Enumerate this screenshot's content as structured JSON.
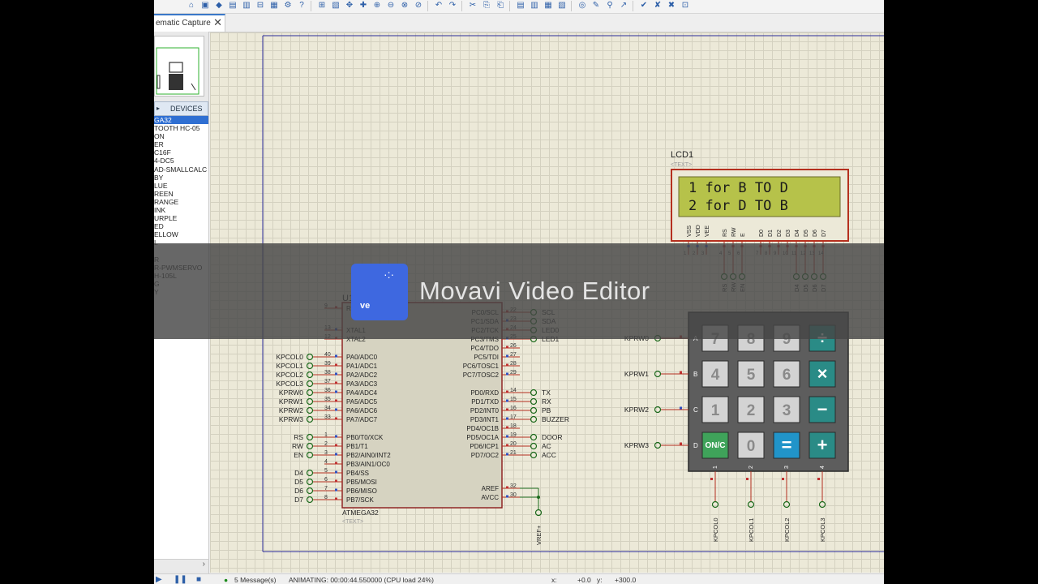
{
  "tab": {
    "title": "ematic Capture",
    "close": "✕"
  },
  "left_panel": {
    "devices_label": "DEVICES",
    "devices": [
      "GA32",
      "TOOTH HC-05",
      "ON",
      "ER",
      "C16F",
      "4-DC5",
      "AD-SMALLCALC",
      "BY",
      "LUE",
      "REEN",
      "RANGE",
      "INK",
      "URPLE",
      "ED",
      "ELLOW",
      "L",
      "",
      "R",
      "R-PWMSERVO",
      "H-105L",
      "G",
      "Y"
    ]
  },
  "lcd": {
    "ref": "LCD1",
    "text_tag": "<TEXT>",
    "line1": "1 for B TO D",
    "line2": "2 for D TO B",
    "pins": [
      "VSS",
      "VDD",
      "VEE",
      "RS",
      "RW",
      "E",
      "D0",
      "D1",
      "D2",
      "D3",
      "D4",
      "D5",
      "D6",
      "D7"
    ],
    "pin_nums": [
      "1",
      "2",
      "3",
      "4",
      "5",
      "6",
      "7",
      "8",
      "9",
      "10",
      "11",
      "12",
      "13",
      "14"
    ],
    "net_labels_rs": [
      "RS",
      "RW",
      "EN"
    ],
    "net_labels_d": [
      "D4",
      "D5",
      "D6",
      "D7"
    ]
  },
  "mcu": {
    "ref": "U1",
    "part": "ATMEGA32",
    "text_tag": "<TEXT>",
    "left_pins": [
      {
        "num": "9",
        "name": "RESET",
        "net": ""
      },
      {
        "num": "13",
        "name": "XTAL1",
        "net": ""
      },
      {
        "num": "12",
        "name": "XTAL2",
        "net": ""
      },
      {
        "num": "40",
        "name": "PA0/ADC0",
        "net": "KPCOL0"
      },
      {
        "num": "39",
        "name": "PA1/ADC1",
        "net": "KPCOL1"
      },
      {
        "num": "38",
        "name": "PA2/ADC2",
        "net": "KPCOL2"
      },
      {
        "num": "37",
        "name": "PA3/ADC3",
        "net": "KPCOL3"
      },
      {
        "num": "36",
        "name": "PA4/ADC4",
        "net": "KPRW0"
      },
      {
        "num": "35",
        "name": "PA5/ADC5",
        "net": "KPRW1"
      },
      {
        "num": "34",
        "name": "PA6/ADC6",
        "net": "KPRW2"
      },
      {
        "num": "33",
        "name": "PA7/ADC7",
        "net": "KPRW3"
      },
      {
        "num": "1",
        "name": "PB0/T0/XCK",
        "net": "RS"
      },
      {
        "num": "2",
        "name": "PB1/T1",
        "net": "RW"
      },
      {
        "num": "3",
        "name": "PB2/AIN0/INT2",
        "net": "EN"
      },
      {
        "num": "4",
        "name": "PB3/AIN1/OC0",
        "net": ""
      },
      {
        "num": "5",
        "name": "PB4/SS",
        "net": "D4"
      },
      {
        "num": "6",
        "name": "PB5/MOSI",
        "net": "D5"
      },
      {
        "num": "7",
        "name": "PB6/MISO",
        "net": "D6"
      },
      {
        "num": "8",
        "name": "PB7/SCK",
        "net": "D7"
      }
    ],
    "right_pins": [
      {
        "num": "22",
        "name": "PC0/SCL",
        "net": "SCL"
      },
      {
        "num": "23",
        "name": "PC1/SDA",
        "net": "SDA"
      },
      {
        "num": "24",
        "name": "PC2/TCK",
        "net": "LED0"
      },
      {
        "num": "25",
        "name": "PC3/TMS",
        "net": "LED1"
      },
      {
        "num": "26",
        "name": "PC4/TDO",
        "net": ""
      },
      {
        "num": "27",
        "name": "PC5/TDI",
        "net": ""
      },
      {
        "num": "28",
        "name": "PC6/TOSC1",
        "net": ""
      },
      {
        "num": "29",
        "name": "PC7/TOSC2",
        "net": ""
      },
      {
        "num": "14",
        "name": "PD0/RXD",
        "net": "TX"
      },
      {
        "num": "15",
        "name": "PD1/TXD",
        "net": "RX"
      },
      {
        "num": "16",
        "name": "PD2/INT0",
        "net": "PB"
      },
      {
        "num": "17",
        "name": "PD3/INT1",
        "net": "BUZZER"
      },
      {
        "num": "18",
        "name": "PD4/OC1B",
        "net": ""
      },
      {
        "num": "19",
        "name": "PD5/OC1A",
        "net": "DOOR"
      },
      {
        "num": "20",
        "name": "PD6/ICP1",
        "net": "AC"
      },
      {
        "num": "21",
        "name": "PD7/OC2",
        "net": "ACC"
      },
      {
        "num": "32",
        "name": "AREF",
        "net": ""
      },
      {
        "num": "30",
        "name": "AVCC",
        "net": ""
      }
    ],
    "vref_label": "VREF+"
  },
  "keypad": {
    "rows": [
      {
        "net": "KPRW0",
        "letter": "A",
        "keys": [
          "7",
          "8",
          "9",
          "÷"
        ]
      },
      {
        "net": "KPRW1",
        "letter": "B",
        "keys": [
          "4",
          "5",
          "6",
          "×"
        ]
      },
      {
        "net": "KPRW2",
        "letter": "C",
        "keys": [
          "1",
          "2",
          "3",
          "−"
        ]
      },
      {
        "net": "KPRW3",
        "letter": "D",
        "keys": [
          "ON/C",
          "0",
          "=",
          "+"
        ]
      }
    ],
    "col_nums": [
      "1",
      "2",
      "3",
      "4"
    ],
    "col_nets": [
      "KPCOL0",
      "KPCOL1",
      "KPCOL2",
      "KPCOL3"
    ]
  },
  "status": {
    "messages": "5 Message(s)",
    "animating": "ANIMATING: 00:00:44.550000 (CPU load 24%)",
    "x_label": "x:",
    "x_value": "+0.0",
    "y_label": "y:",
    "y_value": "+300.0"
  },
  "overlay": {
    "text": "Movavi Video Editor",
    "logo_text": "ve"
  },
  "colors": {
    "lcd_bg": "#b6c24a",
    "lcd_frame": "#b5301f",
    "wire": "#b5301f",
    "mcu_fill": "#d6d3c1",
    "key_gray": "#d3d3d3",
    "key_teal": "#2a8b86",
    "key_blue": "#2194c9",
    "key_green": "#3fa35a",
    "overlay_blue": "#3e68e0"
  }
}
